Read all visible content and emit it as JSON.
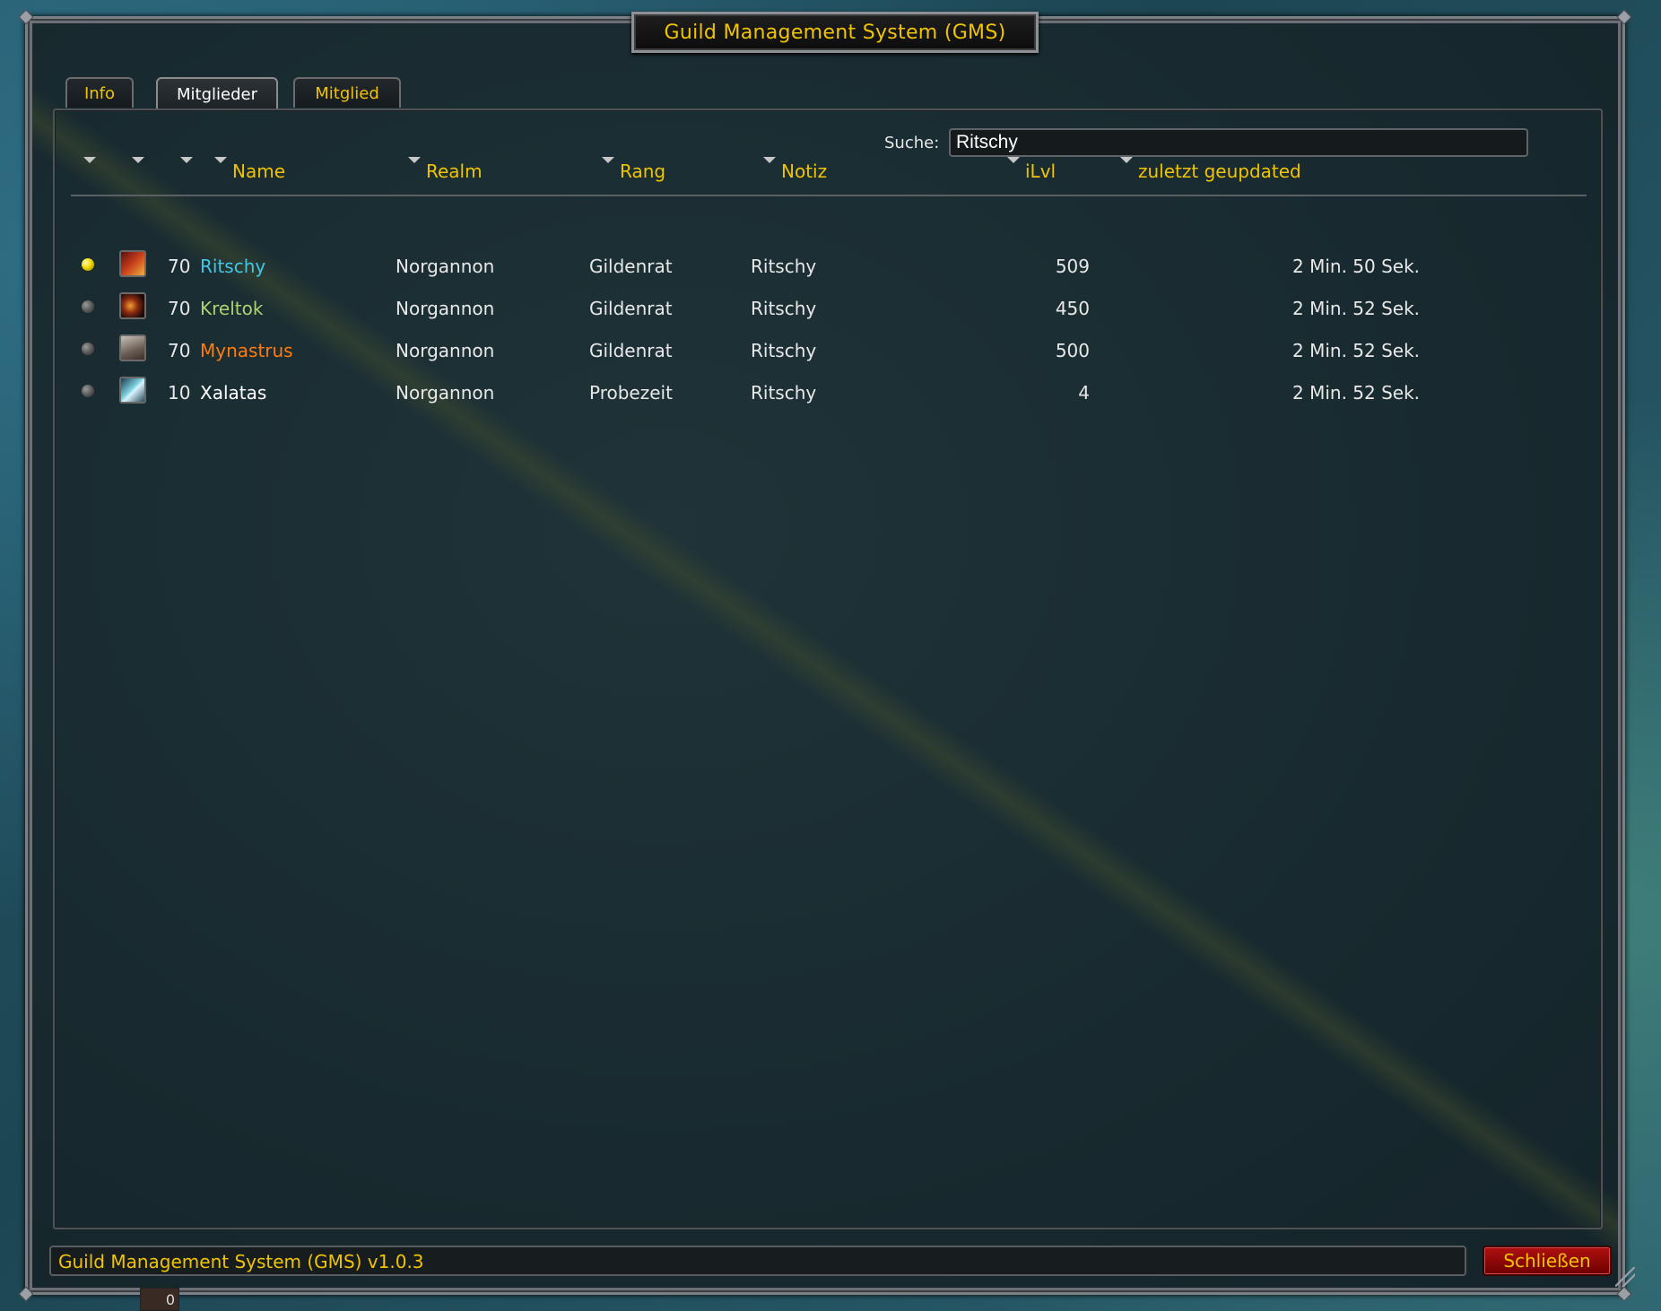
{
  "window": {
    "title": "Guild Management System (GMS)"
  },
  "tabs": [
    {
      "label": "Info",
      "active": false
    },
    {
      "label": "Mitglieder",
      "active": true
    },
    {
      "label": "Mitglied",
      "active": false
    }
  ],
  "search": {
    "label": "Suche:",
    "value": "Ritschy"
  },
  "columns": {
    "name": "Name",
    "realm": "Realm",
    "rank": "Rang",
    "note": "Notiz",
    "ilvl": "iLvl",
    "updated": "zuletzt geupdated"
  },
  "members": [
    {
      "online": true,
      "class_icon": "mage-icon",
      "level": "70",
      "name": "Ritschy",
      "name_color": "#3fc7eb",
      "realm": "Norgannon",
      "rank": "Gildenrat",
      "note": "Ritschy",
      "ilvl": "509",
      "updated": "2 Min. 50 Sek."
    },
    {
      "online": false,
      "class_icon": "hunter-icon",
      "level": "70",
      "name": "Kreltok",
      "name_color": "#aad372",
      "realm": "Norgannon",
      "rank": "Gildenrat",
      "note": "Ritschy",
      "ilvl": "450",
      "updated": "2 Min. 52 Sek."
    },
    {
      "online": false,
      "class_icon": "druid-icon",
      "level": "70",
      "name": "Mynastrus",
      "name_color": "#ff7c0a",
      "realm": "Norgannon",
      "rank": "Gildenrat",
      "note": "Ritschy",
      "ilvl": "500",
      "updated": "2 Min. 52 Sek."
    },
    {
      "online": false,
      "class_icon": "priest-icon",
      "level": "10",
      "name": "Xalatas",
      "name_color": "#ffffff",
      "realm": "Norgannon",
      "rank": "Probezeit",
      "note": "Ritschy",
      "ilvl": "4",
      "updated": "2 Min. 52 Sek."
    }
  ],
  "status_bar": {
    "text": "Guild Management System (GMS) v1.0.3"
  },
  "close_button": {
    "label": "Schließen"
  },
  "bag_counter": "0",
  "colors": {
    "accent_gold": "#f0c400",
    "close_red": "#9a0a0a"
  }
}
